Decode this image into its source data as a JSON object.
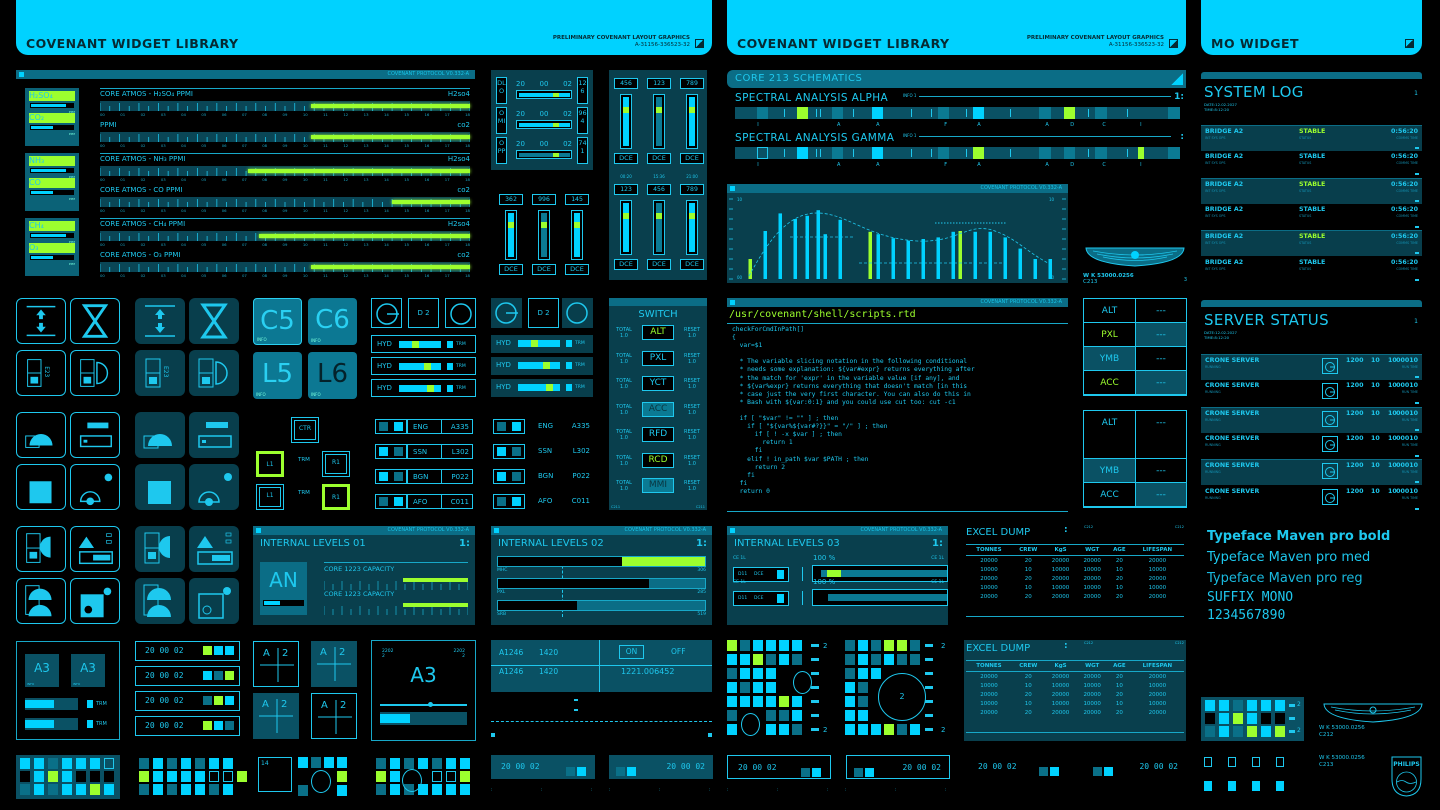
{
  "headers": [
    {
      "title": "COVENANT WIDGET LIBRARY",
      "note": "PRELIMINARY COVENANT LAYOUT GRAPHICS",
      "code": "A-31156-336523-32"
    },
    {
      "title": "COVENANT WIDGET LIBRARY",
      "note": "PRELIMINARY COVENANT LAYOUT GRAPHICS",
      "code": "A-31156-336523-32"
    },
    {
      "title": "MO WIDGET"
    }
  ],
  "protocol": "COVENANT PROTOCOL V0.332-A",
  "colors": {
    "accent": "#00d2ff",
    "panel": "#093f4d",
    "highlight": "#9cff2e"
  },
  "atmos": {
    "tick_labels": [
      "00",
      "01",
      "02",
      "03",
      "04",
      "05",
      "06",
      "07",
      "08",
      "09",
      "10",
      "11",
      "12",
      "13",
      "14",
      "15",
      "16",
      "17",
      "18"
    ],
    "unit": "PPM",
    "groups": [
      {
        "gases": [
          {
            "name": "H₂SO₄",
            "level": 0.8
          },
          {
            "name": "CO₂",
            "level": 0.5
          }
        ],
        "meters": [
          {
            "label": "CORE ATMOS - H₂SO₄ PPMI",
            "tag": "H2so4",
            "start": 0.57
          },
          {
            "label": "PPMI",
            "tag": "co2",
            "start": 0.57
          }
        ]
      },
      {
        "gases": [
          {
            "name": "NH₃",
            "level": 0.8
          },
          {
            "name": "CO",
            "level": 0.5
          }
        ],
        "meters": [
          {
            "label": "CORE ATMOS - NH₃ PPMI",
            "tag": "H2so4",
            "start": 0.4
          },
          {
            "label": "CORE ATMOS - CO PPMI",
            "tag": "co2",
            "start": 0.79
          }
        ]
      },
      {
        "gases": [
          {
            "name": "CH₄",
            "level": 0.8
          },
          {
            "name": "O₃",
            "level": 0.5
          }
        ],
        "meters": [
          {
            "label": "CORE ATMOS - CH₄ PPMI",
            "tag": "H2so4",
            "start": 0.43
          },
          {
            "label": "CORE ATMOS - O₃ PPMI",
            "tag": "co2",
            "start": 0.57
          }
        ]
      }
    ]
  },
  "dlo": {
    "rows": [
      {
        "code": "DLO",
        "time": [
          "20",
          "00",
          "02"
        ],
        "side": "126",
        "bright": true
      },
      {
        "code": "OMI",
        "time": [
          "20",
          "00",
          "02"
        ],
        "side": "964",
        "bright": true
      },
      {
        "code": "OPP",
        "time": [
          "20",
          "00",
          "02"
        ],
        "side": "741",
        "bright": false
      }
    ]
  },
  "sliders_small": {
    "label": "DCE",
    "items": [
      {
        "value": "362",
        "bright": true
      },
      {
        "value": "996",
        "bright": false
      },
      {
        "value": "145",
        "bright": true
      }
    ]
  },
  "sliders_big": {
    "label": "DCE",
    "times": [
      "00:20",
      "15:36",
      "21:00"
    ],
    "top": [
      {
        "value": "456",
        "bright": true
      },
      {
        "value": "123",
        "bright": false
      },
      {
        "value": "789",
        "bright": true
      }
    ],
    "bottom": [
      {
        "value": "123",
        "bright": true
      },
      {
        "value": "456",
        "bright": false
      },
      {
        "value": "789",
        "bright": true
      }
    ]
  },
  "schematics": {
    "title": "CORE 213 SCHEMATICS",
    "info": "INFO 1",
    "alpha": {
      "title": "SPECTRAL ANALYSIS ALPHA",
      "page": "1:",
      "letters": [
        "I",
        "A",
        "A",
        "F",
        "A",
        "A",
        "D",
        "C",
        "I"
      ],
      "blocks": [
        "m",
        "g",
        "m",
        "c",
        "m",
        "c",
        "m",
        "g",
        "m",
        "m"
      ]
    },
    "gamma": {
      "title": "SPECTRAL ANALYSIS GAMMA",
      "page": ":",
      "letters": [
        "I",
        "A",
        "A",
        "F",
        "A",
        "A",
        "D",
        "C",
        "I"
      ],
      "blocks": [
        "o",
        "c",
        "m",
        "c",
        "m",
        "g",
        "m",
        "m",
        "m",
        "g",
        "m"
      ]
    }
  },
  "core_chart": {
    "type": "bar",
    "ymax_label": "10",
    "ymin_label": "00",
    "ylim": [
      0,
      10
    ],
    "values": [
      2.5,
      6,
      8.2,
      7.5,
      7.9,
      8.6,
      5.6,
      7.4,
      5.9,
      5.6,
      5.1,
      4.8,
      5,
      5.2,
      5.9,
      6,
      5.9,
      5.9,
      5.2,
      3.8,
      2.5,
      2.5
    ],
    "highlight_index": [
      0,
      8,
      15
    ]
  },
  "emblem": {
    "code": "W K 53000.0256",
    "sub": "C213",
    "num": "3"
  },
  "tiles": [
    {
      "label": "C5",
      "info": "INFO"
    },
    {
      "label": "C6",
      "info": "INFO"
    },
    {
      "label": "L5",
      "info": "INFO"
    },
    {
      "label": "L6",
      "info": "INFO"
    }
  ],
  "ctr": {
    "center": "CTR",
    "trm": "TRM",
    "l1": "L1",
    "r1": "R1"
  },
  "hyd": {
    "top": "D 2",
    "label": "HYD",
    "trm": "TRM",
    "knobs": [
      0.4,
      0.7,
      0.75
    ],
    "knobs2": [
      0.4,
      0.7,
      0.75
    ]
  },
  "eng": {
    "rows": [
      {
        "name": "ENG",
        "code": "A335",
        "a": "d",
        "b": "c"
      },
      {
        "name": "SSN",
        "code": "L302",
        "a": "c",
        "b": "d"
      },
      {
        "name": "BGN",
        "code": "P022",
        "a": "c",
        "b": "d"
      },
      {
        "name": "AFO",
        "code": "C011",
        "a": "d",
        "b": "c"
      }
    ]
  },
  "switch": {
    "title": "SWITCH",
    "total": "TOTAL",
    "reset": "RESET",
    "val": "1.0",
    "foot": "C211",
    "items": [
      {
        "label": "ALT",
        "style": "lime"
      },
      {
        "label": "PXL",
        "style": "plain"
      },
      {
        "label": "YCT",
        "style": "plain"
      },
      {
        "label": "ACC",
        "style": "fill"
      },
      {
        "label": "RFD",
        "style": "plain"
      },
      {
        "label": "RCD",
        "style": "lime"
      },
      {
        "label": "MMI",
        "style": "fill"
      }
    ]
  },
  "script": {
    "path": "/usr/covenant/shell/scripts.rtd",
    "lines": [
      "checkForCmdInPath[]",
      "{",
      "  var=$1",
      "",
      "  * The variable slicing notation in the following conditional",
      "  * needs some explanation: ${var#expr} returns everything after",
      "  * the match for 'expr' in the variable value [if any], and",
      "  * ${var%expr} returns everything that doesn't match [in this",
      "  * case just the very first character. You can also do this in",
      "  * Bash with ${var:0:1} and you could use cut too: cut -c1",
      "",
      "  if [ \"$var\" != \"\" ] ; then",
      "    if [ \"${var%${var#?}}\" = \"/\" ] ; then",
      "      if [ ! -x $var ] ; then",
      "        return 1",
      "      fi",
      "    elif ! in_path $var $PATH ; then",
      "      return 2",
      "    fi",
      "  fi",
      "  return 0"
    ]
  },
  "readouts": [
    {
      "rows": [
        {
          "k": "ALT",
          "v": "---",
          "ks": "plain",
          "vs": "plain"
        },
        {
          "k": "PXL",
          "v": "---",
          "ks": "lime",
          "vs": "fill"
        },
        {
          "k": "YMB",
          "v": "---",
          "ks": "fill",
          "vs": "plain"
        },
        {
          "k": "ACC",
          "v": "---",
          "ks": "lime",
          "vs": "fill"
        }
      ]
    },
    {
      "rows": [
        {
          "k": "ALT",
          "v": "---",
          "ks": "plain",
          "vs": "plain",
          "tall": true
        },
        {
          "k": "YMB",
          "v": "---",
          "ks": "fill",
          "vs": "plain"
        },
        {
          "k": "ACC",
          "v": "---",
          "ks": "plain",
          "vs": "fill"
        }
      ]
    }
  ],
  "system_log": {
    "title": "SYSTEM LOG",
    "page": "1",
    "date": "DATE:12.02.2027",
    "time": "TIME:8:12:20",
    "rows": [
      {
        "name": "BRIDGE A2",
        "sub": "INT SYS OPS",
        "status": "STABLE",
        "status_sub": "STATUS",
        "time": "0:56:20",
        "time_sub": "COMMS TIME",
        "hl": true
      },
      {
        "name": "BRIDGE A2",
        "sub": "INT SYS OPS",
        "status": "STABLE",
        "status_sub": "STATUS",
        "time": "0:56:20",
        "time_sub": "COMMS TIME",
        "hl": false
      },
      {
        "name": "BRIDGE A2",
        "sub": "INT SYS OPS",
        "status": "STABLE",
        "status_sub": "STATUS",
        "time": "0:56:20",
        "time_sub": "COMMS TIME",
        "hl": true
      },
      {
        "name": "BRIDGE A2",
        "sub": "INT SYS OPS",
        "status": "STABLE",
        "status_sub": "STATUS",
        "time": "0:56:20",
        "time_sub": "COMMS TIME",
        "hl": false
      },
      {
        "name": "BRIDGE A2",
        "sub": "INT SYS OPS",
        "status": "STABLE",
        "status_sub": "STATUS",
        "time": "0:56:20",
        "time_sub": "COMMS TIME",
        "hl": true
      },
      {
        "name": "BRIDGE A2",
        "sub": "INT SYS OPS",
        "status": "STABLE",
        "status_sub": "STATUS",
        "time": "0:56:20",
        "time_sub": "COMMS TIME",
        "hl": false
      }
    ]
  },
  "server_status": {
    "title": "SERVER STATUS",
    "page": "1",
    "date": "DATE:12.02.2027",
    "time": "TIME:8:12:20",
    "rows": [
      {
        "name": "CRONE SERVER",
        "sub": "RUNNING",
        "a": "1200",
        "b": "10",
        "c": "10",
        "d": "00010",
        "d_sub": "RUN TIME",
        "hl": true
      },
      {
        "name": "CRONE SERVER",
        "sub": "RUNNING",
        "a": "1200",
        "b": "10",
        "c": "10",
        "d": "00010",
        "d_sub": "RUN TIME",
        "hl": false
      },
      {
        "name": "CRONE SERVER",
        "sub": "RUNNING",
        "a": "1200",
        "b": "10",
        "c": "10",
        "d": "00010",
        "d_sub": "RUN TIME",
        "hl": true
      },
      {
        "name": "CRONE SERVER",
        "sub": "RUNNING",
        "a": "1200",
        "b": "10",
        "c": "10",
        "d": "00010",
        "d_sub": "RUN TIME",
        "hl": false
      },
      {
        "name": "CRONE SERVER",
        "sub": "RUNNING",
        "a": "1200",
        "b": "10",
        "c": "10",
        "d": "00010",
        "d_sub": "RUN TIME",
        "hl": true
      },
      {
        "name": "CRONE SERVER",
        "sub": "RUNNING",
        "a": "1200",
        "b": "10",
        "c": "10",
        "d": "00010",
        "d_sub": "RUN TIME",
        "hl": false
      }
    ]
  },
  "typeface": [
    "Typeface Maven pro bold",
    "Typeface Maven pro med",
    "Typeface Maven pro reg",
    "SUFFIX MONO",
    "1234567890"
  ],
  "levels1": {
    "title": "INTERNAL LEVELS 01",
    "page": "1:",
    "big": "AN",
    "cap": "CORE 1223 CAPACITY",
    "starts": [
      0.55,
      0.55
    ]
  },
  "levels2": {
    "title": "INTERNAL LEVELS 02",
    "page": "1:",
    "bars": [
      {
        "label": "MHC",
        "value": "306",
        "black": 0.6,
        "lime": true
      },
      {
        "label": "PXL",
        "value": "285",
        "black": 0.73,
        "lime": false
      },
      {
        "label": "SRB",
        "value": "519",
        "black": 0.38,
        "lime": false
      }
    ]
  },
  "levels3": {
    "title": "INTERNAL LEVELS 03",
    "page": "1:",
    "ce": "CE 1L",
    "d": "D11",
    "dce": "DCE",
    "pct": "100 %"
  },
  "excel": {
    "title": "EXCEL DUMP",
    "tag": "C212",
    "headers": [
      "TONNES",
      "CREW",
      "KgS",
      "WGT",
      "AGE",
      "LIFESPAN"
    ],
    "rows": [
      [
        "20000",
        "20",
        "20000",
        "20000",
        "20",
        "20000"
      ],
      [
        "10000",
        "10",
        "10000",
        "10000",
        "10",
        "10000"
      ],
      [
        "20000",
        "20",
        "20000",
        "20000",
        "20",
        "20000"
      ],
      [
        "10000",
        "10",
        "10000",
        "10000",
        "10",
        "10000"
      ],
      [
        "20000",
        "20",
        "20000",
        "20000",
        "20",
        "20000"
      ]
    ]
  },
  "a3": {
    "label": "A3",
    "trm": "TRM",
    "info": "INFO"
  },
  "clock_rows": [
    {
      "t": "20 00 02",
      "s": "gcc"
    },
    {
      "t": "20 00 02",
      "s": "cdg"
    },
    {
      "t": "20 00 02",
      "s": "dgc"
    },
    {
      "t": "20 00 02",
      "s": "gcd"
    }
  ],
  "a2": {
    "a": "A",
    "n": "2"
  },
  "a3big": {
    "label": "A3",
    "tl": "2202",
    "tl2": "2",
    "tr": "2202",
    "tr2": "2",
    "slider": 0.55,
    "bar": 0.35
  },
  "a1246": {
    "rows": [
      {
        "id": "A1246",
        "v": "1420"
      },
      {
        "id": "A1246",
        "v": "1420"
      }
    ],
    "on": "ON",
    "off": "OFF",
    "reading": "1221.006452"
  },
  "bottom_clock": "20 00 02",
  "grid14": "14",
  "grids": {
    "g1": [
      "ccdccco",
      "kcgckkk",
      "dcdccgc"
    ],
    "g2": [
      "dcdcdcc",
      "gccccoog",
      "dcdccdc"
    ],
    "g4": [
      "dcdcdcc",
      "gc..oog",
      "dcdcccc"
    ],
    "m1": [
      "gdcccc",
      "ccgdcd",
      "dccc..",
      "cdcc..",
      "ccccgc",
      "d..ddc",
      "c..ccd"
    ],
    "m2": [
      "dcdggd",
      "dcdcdd",
      "dcc...",
      "cd....",
      "cd....",
      "cc....",
      "cccgdc"
    ],
    "m3": [
      "ccdccc",
      "kcgckk",
      "dcdgcg"
    ]
  },
  "matrix_num": "2"
}
